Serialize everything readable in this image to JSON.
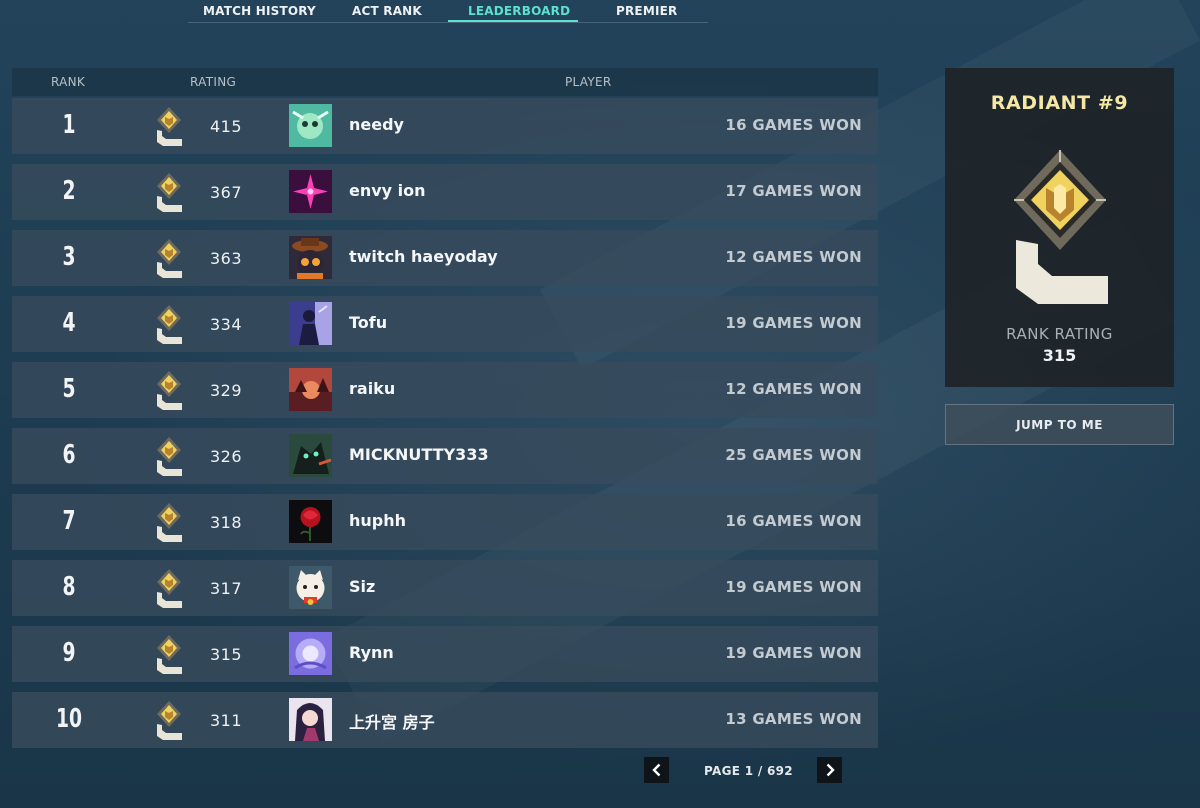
{
  "tabs": [
    {
      "label": "MATCH HISTORY"
    },
    {
      "label": "ACT RANK"
    },
    {
      "label": "LEADERBOARD",
      "active": true
    },
    {
      "label": "PREMIER"
    }
  ],
  "columns": {
    "rank": "RANK",
    "rating": "RATING",
    "player": "PLAYER"
  },
  "rows": [
    {
      "rank": "1",
      "rating": "415",
      "player": "needy",
      "games": "16 GAMES WON",
      "avatar_icon": "green-dragon-avatar"
    },
    {
      "rank": "2",
      "rating": "367",
      "player": "envy ion",
      "games": "17 GAMES WON",
      "avatar_icon": "magenta-flower-avatar"
    },
    {
      "rank": "3",
      "rating": "363",
      "player": "twitch haeyoday",
      "games": "12 GAMES WON",
      "avatar_icon": "hat-creature-avatar"
    },
    {
      "rank": "4",
      "rating": "334",
      "player": "Tofu",
      "games": "19 GAMES WON",
      "avatar_icon": "purple-agent-avatar"
    },
    {
      "rank": "5",
      "rating": "329",
      "player": "raiku",
      "games": "12 GAMES WON",
      "avatar_icon": "red-sunset-avatar"
    },
    {
      "rank": "6",
      "rating": "326",
      "player": "MICKNUTTY333",
      "games": "25 GAMES WON",
      "avatar_icon": "dark-beast-avatar"
    },
    {
      "rank": "7",
      "rating": "318",
      "player": "huphh",
      "games": "16 GAMES WON",
      "avatar_icon": "red-rose-avatar"
    },
    {
      "rank": "8",
      "rating": "317",
      "player": "Siz",
      "games": "19 GAMES WON",
      "avatar_icon": "lucky-cat-avatar"
    },
    {
      "rank": "9",
      "rating": "315",
      "player": "Rynn",
      "games": "19 GAMES WON",
      "avatar_icon": "violet-glow-avatar"
    },
    {
      "rank": "10",
      "rating": "311",
      "player": "上升宮 房子",
      "games": "13 GAMES WON",
      "avatar_icon": "anime-girl-avatar"
    }
  ],
  "pagination": {
    "text": "PAGE 1 / 692",
    "prev_icon": "chevron-left-icon",
    "next_icon": "chevron-right-icon"
  },
  "rank_card": {
    "title": "RADIANT #9",
    "rating_label": "RANK RATING",
    "rating_value": "315",
    "badge_icon": "radiant-rank-icon"
  },
  "jump_button": "JUMP TO ME",
  "colors": {
    "accent": "#5ee0cf",
    "gold": "#f5e7a6",
    "row_bg": "#384c5c"
  }
}
